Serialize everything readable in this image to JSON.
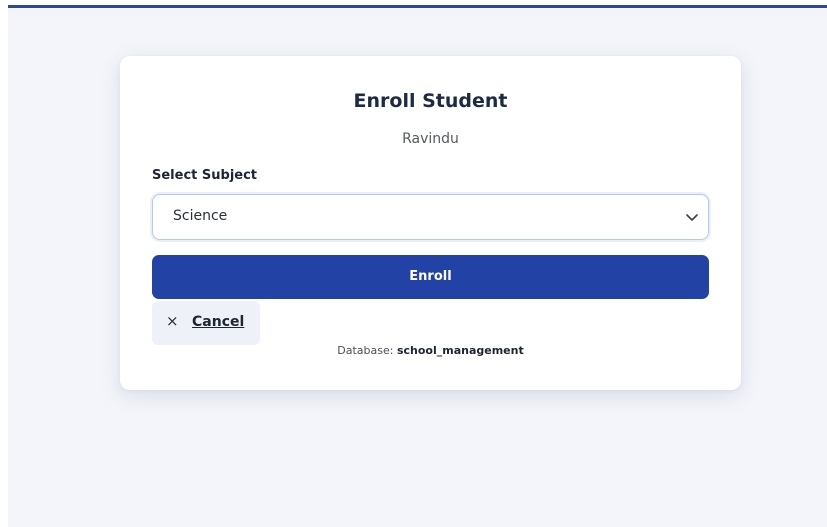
{
  "card": {
    "title": "Enroll Student",
    "student_name": "Ravindu"
  },
  "form": {
    "subject_label": "Select Subject",
    "selected_subject": "Science",
    "dropdown_icon": "chevron-down-icon"
  },
  "actions": {
    "enroll_label": "Enroll",
    "cancel_icon": "close-icon",
    "cancel_symbol": "×",
    "cancel_label": "Cancel"
  },
  "footer": {
    "database_prefix": "Database:",
    "database_name": "school_management"
  },
  "colors": {
    "top_bar": "#2d4a8a",
    "primary_button": "#2342a5",
    "page_background": "#f3f5fa"
  }
}
